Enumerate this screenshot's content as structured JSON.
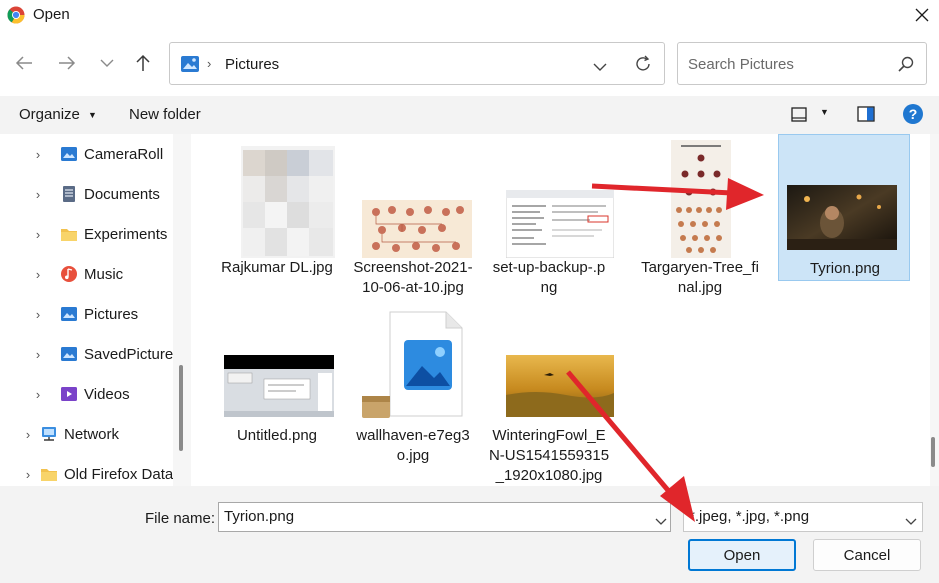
{
  "window": {
    "title": "Open"
  },
  "address": {
    "location": "Pictures"
  },
  "search": {
    "placeholder": "Search Pictures"
  },
  "toolbar": {
    "organize_label": "Organize",
    "new_folder_label": "New folder",
    "help_label": "?"
  },
  "sidebar": {
    "items": [
      {
        "label": "CameraRoll",
        "icon": "pictures-folder-icon"
      },
      {
        "label": "Documents",
        "icon": "documents-icon"
      },
      {
        "label": "Experiments",
        "icon": "folder-icon"
      },
      {
        "label": "Music",
        "icon": "music-icon"
      },
      {
        "label": "Pictures",
        "icon": "pictures-folder-icon"
      },
      {
        "label": "SavedPictures",
        "icon": "pictures-folder-icon"
      },
      {
        "label": "Videos",
        "icon": "videos-icon"
      },
      {
        "label": "Network",
        "icon": "network-icon"
      },
      {
        "label": "Old Firefox Data",
        "icon": "folder-icon"
      }
    ]
  },
  "files": [
    {
      "line1": "Rajkumar DL.jpg",
      "line2": ""
    },
    {
      "line1": "Screenshot-2021-",
      "line2": "10-06-at-10.jpg"
    },
    {
      "line1": "set-up-backup-.p",
      "line2": "ng"
    },
    {
      "line1": "Targaryen-Tree_fi",
      "line2": "nal.jpg"
    },
    {
      "line1": "Tyrion.png",
      "line2": "",
      "selected": true
    },
    {
      "line1": "Untitled.png",
      "line2": ""
    },
    {
      "line1": "wallhaven-e7eg3",
      "line2": "o.jpg"
    },
    {
      "line1": "WinteringFowl_E",
      "line2": "N-US1541559315",
      "line3": "_1920x1080.jpg"
    }
  ],
  "bottom": {
    "file_name_label": "File name:",
    "file_name_value": "Tyrion.png",
    "file_type_value": "*.jpeg, *.jpg, *.png",
    "open_label": "Open",
    "cancel_label": "Cancel"
  },
  "colors": {
    "accent": "#0078d4",
    "selection": "#cce4f7",
    "annotation_arrow": "#e0262b"
  }
}
